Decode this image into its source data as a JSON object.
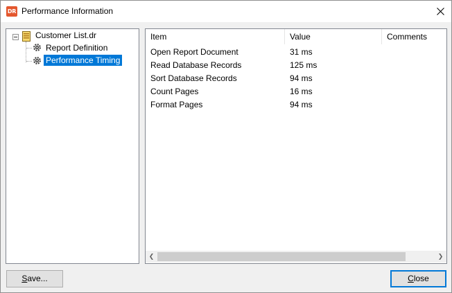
{
  "window": {
    "title": "Performance Information",
    "icon_text": "DR",
    "close_icon": "close-icon"
  },
  "tree": {
    "root": {
      "label": "Customer List.dr",
      "icon": "report-document-icon",
      "expanded": true
    },
    "children": [
      {
        "label": "Report Definition",
        "icon": "gear-icon",
        "selected": false
      },
      {
        "label": "Performance Timing",
        "icon": "gear-icon",
        "selected": true
      }
    ]
  },
  "list": {
    "columns": [
      "Item",
      "Value",
      "Comments"
    ],
    "rows": [
      {
        "item": "Open Report Document",
        "value": "31 ms",
        "comments": ""
      },
      {
        "item": "Read Database Records",
        "value": "125 ms",
        "comments": ""
      },
      {
        "item": "Sort Database Records",
        "value": "94 ms",
        "comments": ""
      },
      {
        "item": "Count Pages",
        "value": "16 ms",
        "comments": ""
      },
      {
        "item": "Format Pages",
        "value": "94 ms",
        "comments": ""
      }
    ]
  },
  "buttons": {
    "save_hotkey": "S",
    "save_rest": "ave...",
    "close_hotkey": "C",
    "close_rest": "lose"
  },
  "colors": {
    "selection": "#0078d7",
    "app_icon": "#e4572e"
  }
}
